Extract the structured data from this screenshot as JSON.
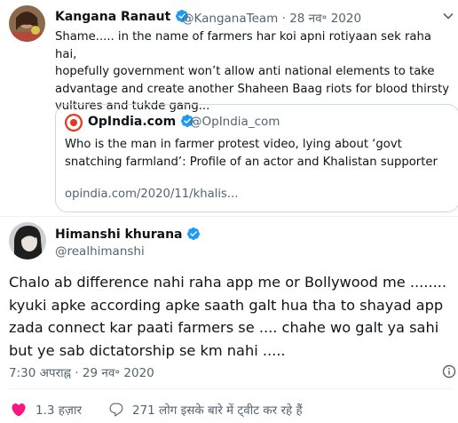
{
  "tweet1": {
    "author_name": "Kangana Ranaut",
    "handle": "@KanganaTeam",
    "separator": "·",
    "date": "28 नव॰ 2020",
    "text_lines": [
      "Shame..... in the name of farmers har koi apni rotiyaan sek raha hai,",
      "hopefully government won’t allow anti national elements to take",
      "advantage and create another Shaheen Baag riots for blood thirsty",
      "vultures and tukde gang..."
    ]
  },
  "quote": {
    "author_name": "OpIndia.com",
    "handle": "@OpIndia_com",
    "text_lines": [
      "Who is the man in farmer protest video, lying about ‘govt",
      "snatching farmland’: Profile of an actor and Khalistan supporter"
    ],
    "link": "opindia.com/2020/11/khalis..."
  },
  "tweet2": {
    "author_name": "Himanshi khurana",
    "handle": "@realhimanshi",
    "text_lines": [
      "Chalo ab difference nahi raha app me or Bollywood me ........",
      "kyuki apke according apke saath galt hua tha to shayad app",
      "zada connect kar paati farmers se .... chahe wo galt ya sahi",
      "but ye sab dictatorship se km nahi ....."
    ],
    "timestamp": "7:30 अपराह्न · 29 नव॰ 2020",
    "likes": "1.3 हज़ार",
    "replies_text": "271 लोग इसके बारे में ट्वीट कर रहे हैं"
  },
  "colors": {
    "verified": "#1d9bf0",
    "like_red": "#f91880",
    "text_secondary": "#536471",
    "border": "#cfd9de"
  },
  "icons": {
    "tweet1_action": "chevron-down-icon",
    "like": "heart-icon",
    "reply": "reply-icon",
    "info": "info-icon"
  }
}
